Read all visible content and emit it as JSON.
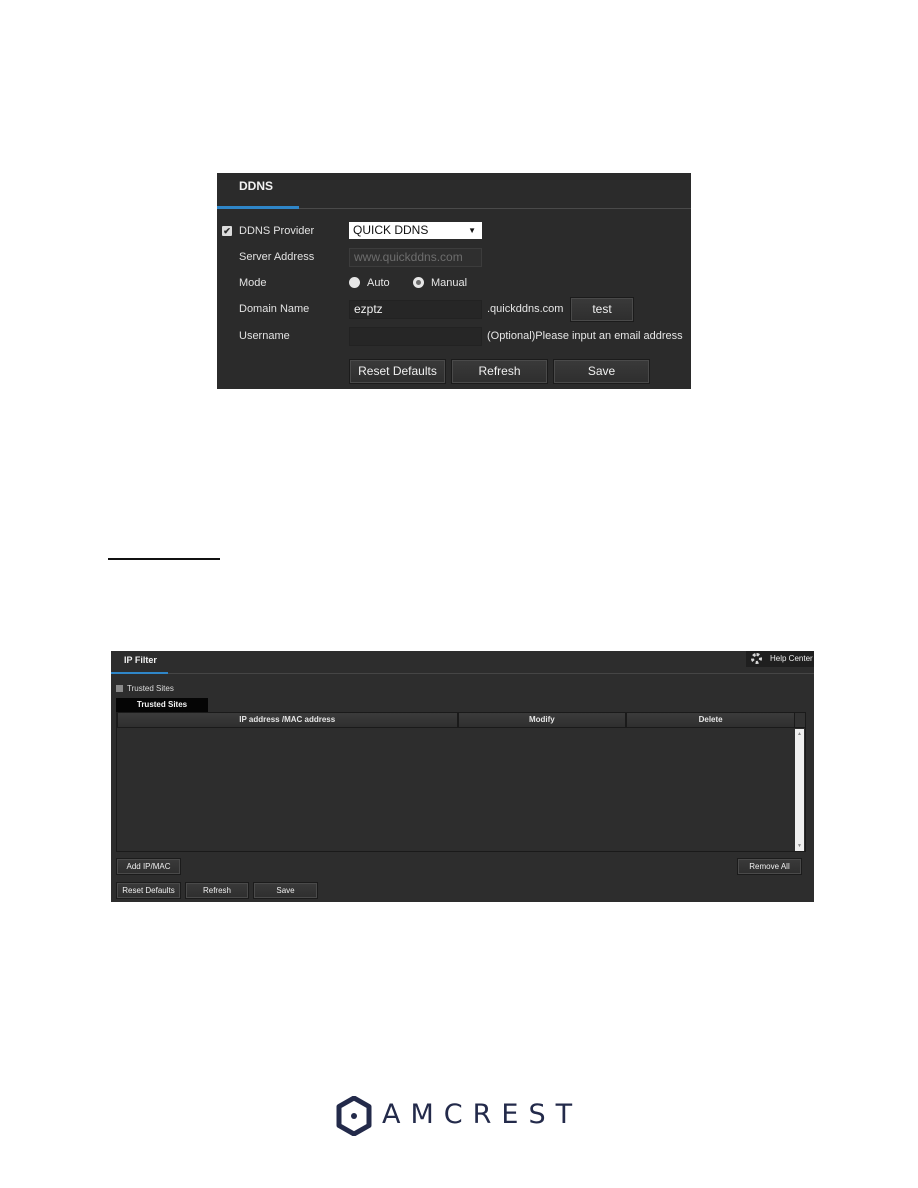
{
  "ddns": {
    "tab_title": "DDNS",
    "provider": {
      "label": "DDNS Provider",
      "enabled": true,
      "selected": "QUICK DDNS"
    },
    "server_address": {
      "label": "Server Address",
      "placeholder": "www.quickddns.com"
    },
    "mode": {
      "label": "Mode",
      "options": [
        "Auto",
        "Manual"
      ],
      "selected": "Manual"
    },
    "domain_name": {
      "label": "Domain Name",
      "value": "ezptz",
      "suffix": ".quickddns.com",
      "test_label": "test"
    },
    "username": {
      "label": "Username",
      "value": "",
      "hint": "(Optional)Please input an email address"
    },
    "buttons": {
      "reset": "Reset Defaults",
      "refresh": "Refresh",
      "save": "Save"
    }
  },
  "ip_filter": {
    "tab_title": "IP Filter",
    "help_center": "Help Center",
    "trusted_sites_checkbox": {
      "label": "Trusted Sites",
      "checked": false
    },
    "subtab": "Trusted Sites",
    "table": {
      "columns": [
        "IP address /MAC address",
        "Modify",
        "Delete"
      ],
      "rows": []
    },
    "buttons": {
      "add": "Add IP/MAC",
      "remove_all": "Remove All",
      "reset": "Reset Defaults",
      "refresh": "Refresh",
      "save": "Save"
    }
  },
  "footer": {
    "brand": "AMCREST",
    "brand_color": "#232a4a",
    "accent_color": "#2f86c8"
  }
}
